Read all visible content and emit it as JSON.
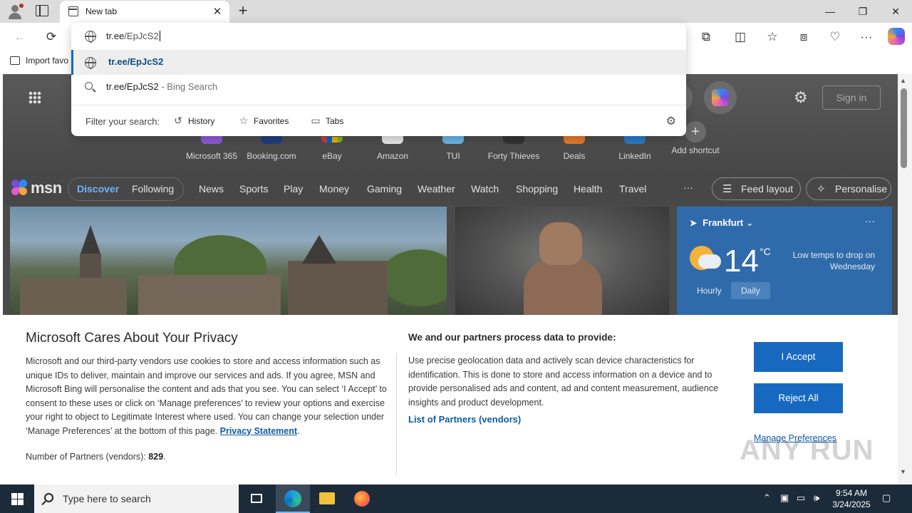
{
  "browser": {
    "tab_title": "New tab",
    "close_symbol": "✕",
    "new_tab_symbol": "+",
    "window_controls": [
      "—",
      "❐",
      "✕"
    ],
    "bookmarks_bar": {
      "import_label": "Import favo"
    }
  },
  "address_bar": {
    "typed_host": "tr.ee",
    "typed_rest": "/EpJcS2",
    "suggestions": [
      {
        "text": "tr.ee/EpJcS2",
        "type": "url"
      },
      {
        "text": "tr.ee/EpJcS2",
        "suffix": " - Bing Search",
        "type": "search"
      }
    ],
    "filter": {
      "label": "Filter your search:",
      "buttons": [
        {
          "label": "History",
          "icon": "history-icon"
        },
        {
          "label": "Favorites",
          "icon": "star-icon"
        },
        {
          "label": "Tabs",
          "icon": "tabs-icon"
        }
      ]
    }
  },
  "new_tab_page": {
    "sign_in": "Sign in",
    "shortcuts": [
      {
        "label": "Microsoft 365",
        "color": "#8d5bd6"
      },
      {
        "label": "Booking.com",
        "color": "#1f3f7a"
      },
      {
        "label": "eBay",
        "color": "#e8e8e8"
      },
      {
        "label": "Amazon",
        "color": "#e8e8e8"
      },
      {
        "label": "TUI",
        "color": "#6ab6e8"
      },
      {
        "label": "Forty Thieves",
        "color": "#333333"
      },
      {
        "label": "Deals",
        "color": "#e47a28"
      },
      {
        "label": "LinkedIn",
        "color": "#2a7ac7"
      },
      {
        "label": "Add shortcut",
        "color": "#6a6a6a"
      }
    ],
    "msn": {
      "logo": "msn",
      "tabs": [
        "Discover",
        "Following"
      ],
      "categories": [
        "News",
        "Sports",
        "Play",
        "Money",
        "Gaming",
        "Weather",
        "Watch",
        "Shopping",
        "Health",
        "Travel"
      ],
      "more": "···",
      "feed_layout": "Feed layout",
      "personalise": "Personalise"
    },
    "weather": {
      "city": "Frankfurt",
      "temp": "14",
      "unit": "°C",
      "note": "Low temps to drop on Wednesday",
      "tabs": [
        "Hourly",
        "Daily"
      ],
      "more": "···"
    }
  },
  "consent": {
    "title": "Microsoft Cares About Your Privacy",
    "body": "Microsoft and our third-party vendors use cookies to store and access information such as unique IDs to deliver, maintain and improve our services and ads. If you agree, MSN and Microsoft Bing will personalise the content and ads that you see. You can select ‘I Accept’ to consent to these uses or click on ‘Manage preferences’ to review your options and exercise your right to object to Legitimate Interest where used.  You can change your selection under ‘Manage Preferences’ at the bottom of this page. ",
    "privacy_link": "Privacy Statement",
    "count_label": "Number of Partners (vendors): ",
    "count_value": "829",
    "right_title": "We and our partners process data to provide:",
    "right_body": "Use precise geolocation data and actively scan device characteristics for identification. This is done to store and access information on a device and to provide personalised ads and content, ad and content measurement, audience insights and product development.",
    "vendors_link": "List of Partners (vendors)",
    "accept": "I Accept",
    "reject": "Reject All",
    "manage": "Manage Preferences",
    "watermark": "ANY RUN"
  },
  "taskbar": {
    "search_placeholder": "Type here to search",
    "time": "9:54 AM",
    "date": "3/24/2025"
  }
}
